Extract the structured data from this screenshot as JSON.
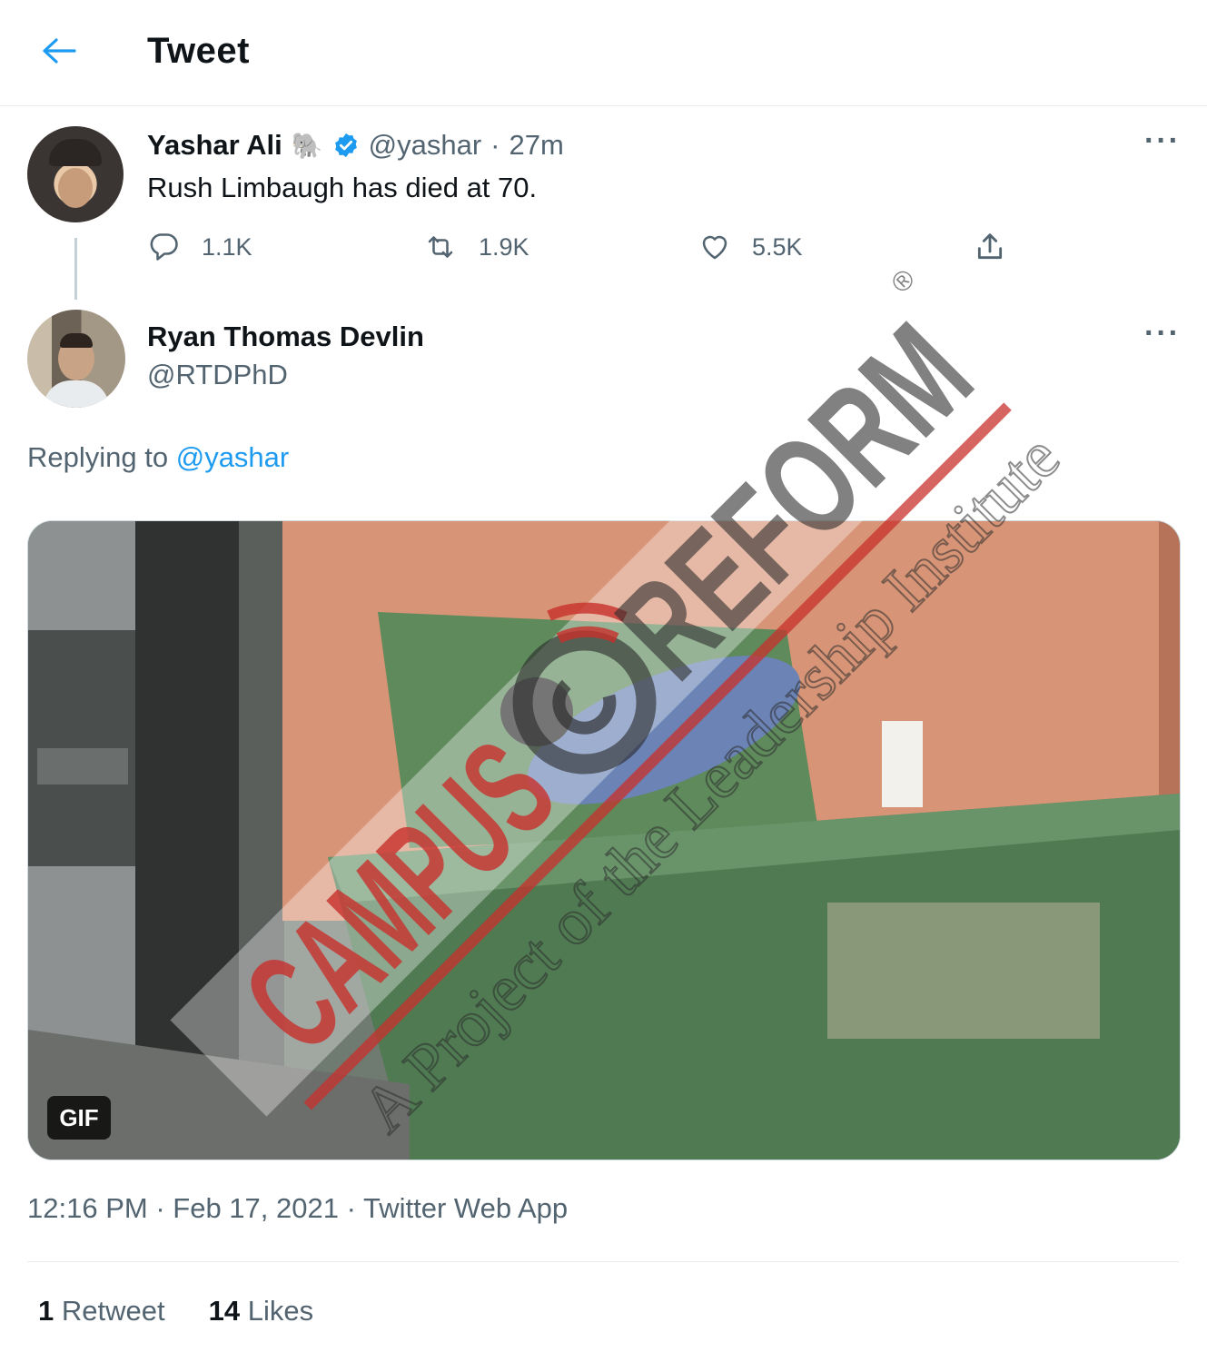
{
  "header": {
    "title": "Tweet",
    "back_icon": "arrow-left-icon",
    "accent": "#1d9bf0"
  },
  "tweet1": {
    "name": "Yashar Ali",
    "emoji": "🐘",
    "verified_icon": "verified-badge-icon",
    "handle": "@yashar",
    "sep": "·",
    "time": "27m",
    "text": "Rush Limbaugh has died at 70.",
    "more": "···",
    "replies": "1.1K",
    "retweets": "1.9K",
    "likes": "5.5K"
  },
  "tweet2": {
    "name": "Ryan Thomas Devlin",
    "handle": "@RTDPhD",
    "more": "···",
    "replying_prefix": "Replying to ",
    "replying_handle": "@yashar",
    "gif_label": "GIF",
    "timestamp": "12:16 PM",
    "date": "Feb 17, 2021",
    "source": "Twitter Web App",
    "sep": "·",
    "retweet_count": "1",
    "retweet_label": "Retweet",
    "like_count": "14",
    "like_label": "Likes"
  },
  "watermark": {
    "brand_left": "CAMPUS",
    "brand_right": "REFORM",
    "registered": "®",
    "tagline": "A Project of the Leadership Institute",
    "color": "#c8302c"
  }
}
